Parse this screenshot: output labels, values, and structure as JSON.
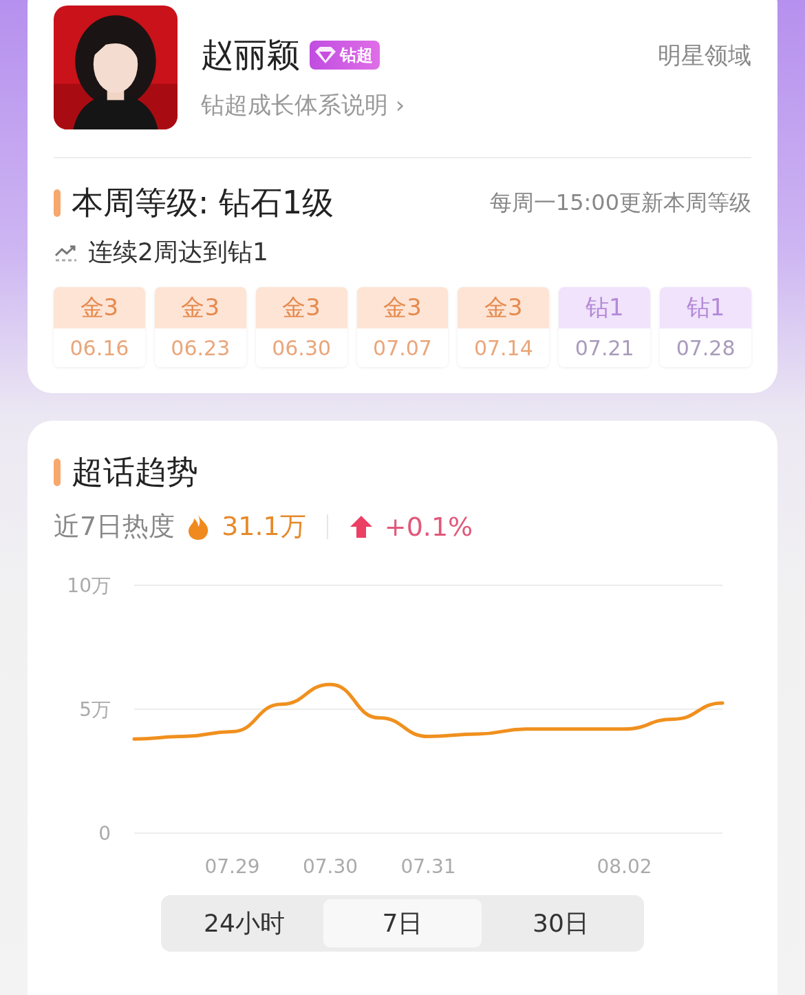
{
  "profile": {
    "name": "赵丽颖",
    "badge": "钻超",
    "link": "钻超成长体系说明",
    "link_arrow": "›",
    "domain": "明星领域"
  },
  "level": {
    "title": "本周等级: 钻石1级",
    "update_note": "每周一15:00更新本周等级",
    "streak": "连续2周达到钻1",
    "weeks": [
      {
        "kind": "gold",
        "grade": "金3",
        "date": "06.16"
      },
      {
        "kind": "gold",
        "grade": "金3",
        "date": "06.23"
      },
      {
        "kind": "gold",
        "grade": "金3",
        "date": "06.30"
      },
      {
        "kind": "gold",
        "grade": "金3",
        "date": "07.07"
      },
      {
        "kind": "gold",
        "grade": "金3",
        "date": "07.14"
      },
      {
        "kind": "diamond",
        "grade": "钻1",
        "date": "07.21"
      },
      {
        "kind": "diamond",
        "grade": "钻1",
        "date": "07.28"
      }
    ]
  },
  "trend": {
    "title": "超话趋势",
    "heat_label": "近7日热度",
    "heat_value": "31.1万",
    "change": "+0.1%",
    "chart_data": {
      "type": "line",
      "categories": [
        null,
        null,
        "07.29",
        null,
        "07.30",
        null,
        "07.31",
        null,
        null,
        null,
        "08.02",
        null,
        null
      ],
      "series": [
        {
          "color": "#f0901e",
          "values": [
            3.8,
            3.9,
            4.1,
            5.2,
            6.0,
            4.65,
            3.9,
            4.0,
            4.2,
            4.2,
            4.2,
            4.6,
            5.25
          ]
        }
      ],
      "ylim": [
        0,
        10
      ],
      "yticks": [
        {
          "value": 0,
          "label": "0"
        },
        {
          "value": 5,
          "label": "5万"
        },
        {
          "value": 10,
          "label": "10万"
        }
      ]
    },
    "ranges": [
      {
        "label": "24小时",
        "selected": false
      },
      {
        "label": "7日",
        "selected": true
      },
      {
        "label": "30日",
        "selected": false
      }
    ]
  }
}
